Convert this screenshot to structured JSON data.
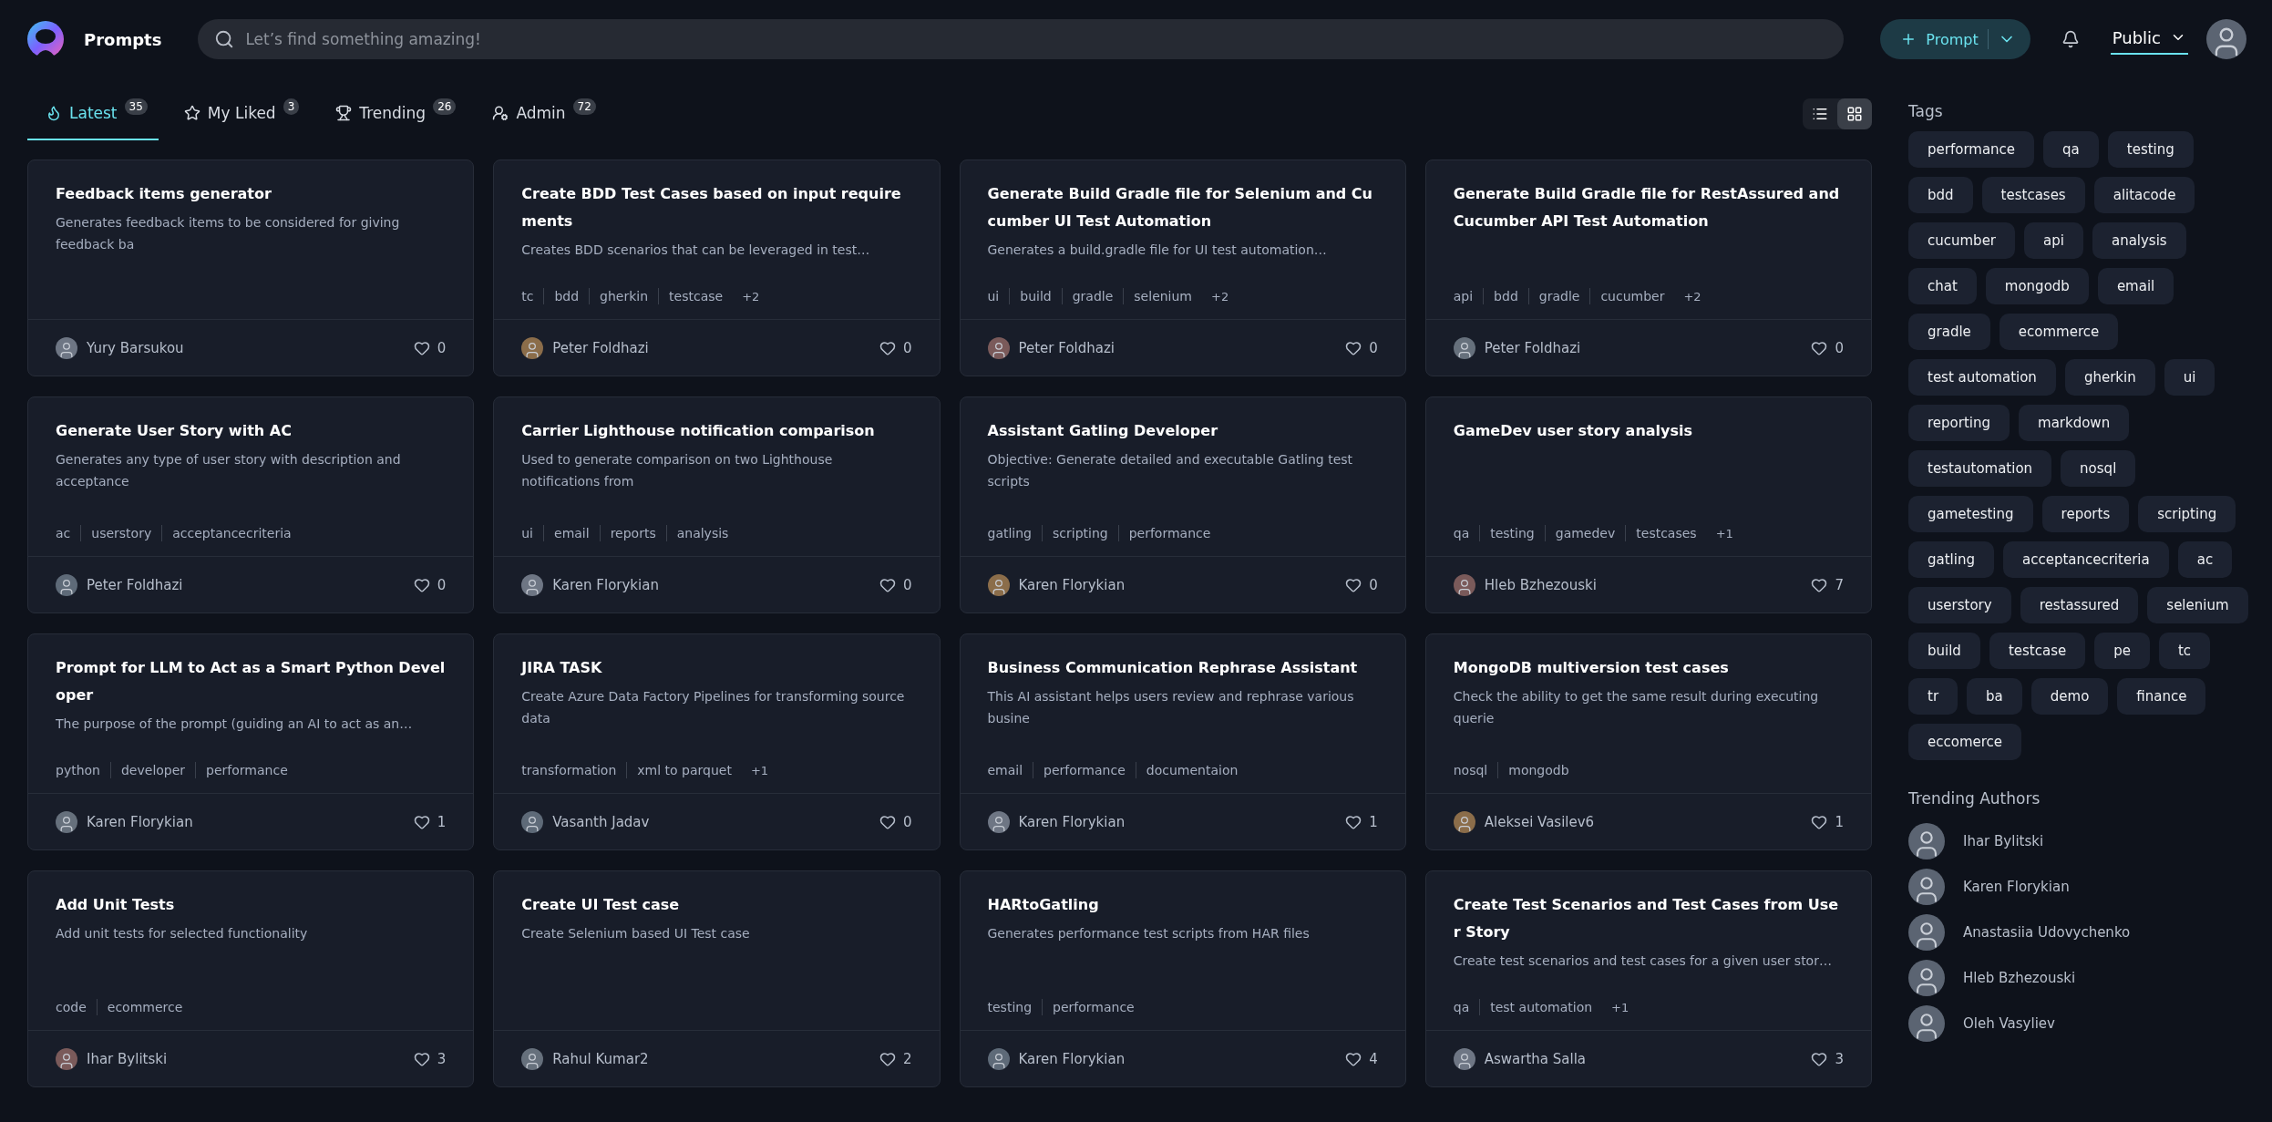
{
  "header": {
    "title": "Prompts",
    "search": {
      "placeholder": "Let’s find something amazing!"
    },
    "new_button": "Prompt",
    "visibility": "Public"
  },
  "tabs": [
    {
      "label": "Latest",
      "count": "35",
      "selected": true
    },
    {
      "label": "My Liked",
      "count": "3",
      "selected": false
    },
    {
      "label": "Trending",
      "count": "26",
      "selected": false
    },
    {
      "label": "Admin",
      "count": "72",
      "selected": false
    }
  ],
  "view_modes": [
    {
      "kind": "list",
      "selected": false
    },
    {
      "kind": "grid",
      "selected": true
    }
  ],
  "cards": [
    {
      "title": "Feedback items generator",
      "description": "Generates feedback items to be considered for giving feedback ba",
      "author": "Yury Barsukou",
      "likes": "0"
    },
    {
      "title": "Create BDD Test Cases based on input requirements",
      "description": "Creates BDD scenarios that can be leveraged in test…",
      "tags": [
        "tc",
        "bdd",
        "gherkin",
        "testcase"
      ],
      "more": "+2",
      "author": "Peter Foldhazi",
      "likes": "0"
    },
    {
      "title": "Generate Build Gradle file for Selenium and Cucumber UI Test Automation",
      "description": "Generates a build.gradle file for UI test automation…",
      "tags": [
        "ui",
        "build",
        "gradle",
        "selenium"
      ],
      "more": "+2",
      "author": "Peter Foldhazi",
      "likes": "0"
    },
    {
      "title": "Generate Build Gradle file for RestAssured and Cucumber API Test Automation",
      "tags": [
        "api",
        "bdd",
        "gradle",
        "cucumber"
      ],
      "more": "+2",
      "author": "Peter Foldhazi",
      "likes": "0"
    },
    {
      "title": "Generate User Story with AC",
      "description": "Generates any type of user story with description and acceptance",
      "tags": [
        "ac",
        "userstory",
        "acceptancecriteria"
      ],
      "author": "Peter Foldhazi",
      "likes": "0"
    },
    {
      "title": "Carrier Lighthouse notification comparison",
      "description": "Used to generate comparison on two Lighthouse notifications from",
      "tags": [
        "ui",
        "email",
        "reports",
        "analysis"
      ],
      "author": "Karen Florykian",
      "likes": "0"
    },
    {
      "title": "Assistant Gatling Developer",
      "description": "Objective: Generate detailed and executable Gatling test scripts",
      "tags": [
        "gatling",
        "scripting",
        "performance"
      ],
      "author": "Karen Florykian",
      "likes": "0"
    },
    {
      "title": "GameDev user story analysis",
      "tags": [
        "qa",
        "testing",
        "gamedev",
        "testcases"
      ],
      "more": "+1",
      "author": "Hleb Bzhezouski",
      "likes": "7"
    },
    {
      "title": "Prompt for LLM to Act as a Smart Python Developer",
      "description": "The purpose of the prompt (guiding an AI to act as an…",
      "tags": [
        "python",
        "developer",
        "performance"
      ],
      "author": "Karen Florykian",
      "likes": "1"
    },
    {
      "title": "JIRA TASK",
      "description": "Create Azure Data Factory Pipelines for transforming source data",
      "tags": [
        "transformation",
        "xml to parquet"
      ],
      "more": "+1",
      "author": "Vasanth Jadav",
      "likes": "0"
    },
    {
      "title": "Business Communication Rephrase Assistant",
      "description": "This AI assistant helps users review and rephrase various busine",
      "tags": [
        "email",
        "performance",
        "documentaion"
      ],
      "author": "Karen Florykian",
      "likes": "1"
    },
    {
      "title": "MongoDB multiversion test cases",
      "description": "Check the ability to get the same result during executing querie",
      "tags": [
        "nosql",
        "mongodb"
      ],
      "author": "Aleksei Vasilev6",
      "likes": "1"
    },
    {
      "title": "Add Unit Tests",
      "description": "Add unit tests for selected functionality",
      "tags": [
        "code",
        "ecommerce"
      ],
      "author": "Ihar Bylitski",
      "likes": "3"
    },
    {
      "title": "Create UI Test case",
      "description": "Create Selenium based UI Test case",
      "author": "Rahul Kumar2",
      "likes": "2"
    },
    {
      "title": "HARtoGatling",
      "description": "Generates performance test scripts from HAR files",
      "tags": [
        "testing",
        "performance"
      ],
      "author": "Karen Florykian",
      "likes": "4"
    },
    {
      "title": "Create Test Scenarios and Test Cases from User Story",
      "description": "Create test scenarios and test cases for a given user stor…",
      "tags": [
        "qa",
        "test automation"
      ],
      "more": "+1",
      "author": "Aswartha Salla",
      "likes": "3"
    }
  ],
  "sidebar": {
    "tags_title": "Tags",
    "tags": [
      "performance",
      "qa",
      "testing",
      "bdd",
      "testcases",
      "alitacode",
      "cucumber",
      "api",
      "analysis",
      "chat",
      "mongodb",
      "email",
      "gradle",
      "ecommerce",
      "test automation",
      "gherkin",
      "ui",
      "reporting",
      "markdown",
      "testautomation",
      "nosql",
      "gametesting",
      "reports",
      "scripting",
      "gatling",
      "acceptancecriteria",
      "ac",
      "userstory",
      "restassured",
      "selenium",
      "build",
      "testcase",
      "pe",
      "tc",
      "tr",
      "ba",
      "demo",
      "finance",
      "eccomerce"
    ],
    "authors_title": "Trending Authors",
    "authors": [
      "Ihar Bylitski",
      "Karen Florykian",
      "Anastasiia Udovychenko",
      "Hleb Bzhezouski",
      "Oleh Vasyliev"
    ]
  }
}
